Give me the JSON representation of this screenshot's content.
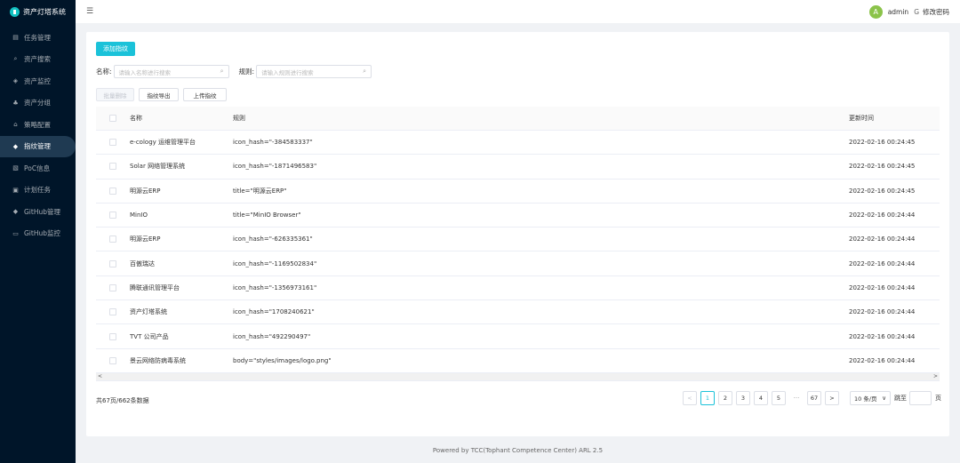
{
  "app": {
    "title": "资产灯塔系统"
  },
  "sidebar": {
    "items": [
      {
        "label": "任务管理",
        "icon": "calendar-icon",
        "glyph": "▤"
      },
      {
        "label": "资产搜索",
        "icon": "search-icon",
        "glyph": "⌕"
      },
      {
        "label": "资产监控",
        "icon": "shield-icon",
        "glyph": "◈"
      },
      {
        "label": "资产分组",
        "icon": "cluster-icon",
        "glyph": "♣"
      },
      {
        "label": "策略配置",
        "icon": "home-icon",
        "glyph": "⌂"
      },
      {
        "label": "指纹管理",
        "icon": "tag-icon",
        "glyph": "◆",
        "active": true
      },
      {
        "label": "PoC信息",
        "icon": "file-icon",
        "glyph": "▧"
      },
      {
        "label": "计划任务",
        "icon": "schedule-icon",
        "glyph": "▣"
      },
      {
        "label": "GitHub管理",
        "icon": "diamond-icon",
        "glyph": "◆"
      },
      {
        "label": "GitHub监控",
        "icon": "monitor-icon",
        "glyph": "▭"
      }
    ]
  },
  "header": {
    "menu_glyph": "☰",
    "avatar_letter": "A",
    "username": "admin",
    "pw_glyph": "G",
    "change_password": "修改密码"
  },
  "toolbar": {
    "add_label": "添加指纹"
  },
  "filters": {
    "name_label": "名称:",
    "name_placeholder": "请输入名称进行搜索",
    "rule_label": "规则:",
    "rule_placeholder": "请输入规则进行搜索",
    "search_glyph": "⌕"
  },
  "actions": {
    "batch_delete": "批量删除",
    "export": "指纹导出",
    "upload": "上传指纹"
  },
  "table": {
    "headers": {
      "name": "名称",
      "rule": "规则",
      "time": "更新时间"
    },
    "rows": [
      {
        "name": "e-cology 运维管理平台",
        "rule": "icon_hash=\"-384583337\"",
        "time": "2022-02-16 00:24:45"
      },
      {
        "name": "Solar 网络管理系统",
        "rule": "icon_hash=\"-1871496583\"",
        "time": "2022-02-16 00:24:45"
      },
      {
        "name": "明源云ERP",
        "rule": "title=\"明源云ERP\"",
        "time": "2022-02-16 00:24:45"
      },
      {
        "name": "MinIO",
        "rule": "title=\"MinIO Browser\"",
        "time": "2022-02-16 00:24:44"
      },
      {
        "name": "明源云ERP",
        "rule": "icon_hash=\"-626335361\"",
        "time": "2022-02-16 00:24:44"
      },
      {
        "name": "百傲瑞达",
        "rule": "icon_hash=\"-1169502834\"",
        "time": "2022-02-16 00:24:44"
      },
      {
        "name": "腾联通讯管理平台",
        "rule": "icon_hash=\"-1356973161\"",
        "time": "2022-02-16 00:24:44"
      },
      {
        "name": "资产灯塔系统",
        "rule": "icon_hash=\"1708240621\"",
        "time": "2022-02-16 00:24:44"
      },
      {
        "name": "TVT 公司产品",
        "rule": "icon_hash=\"492290497\"",
        "time": "2022-02-16 00:24:44"
      },
      {
        "name": "景云网络防病毒系统",
        "rule": "body=\"styles/images/logo.png\"",
        "time": "2022-02-16 00:24:44"
      }
    ],
    "scroll_left": "<",
    "scroll_right": ">"
  },
  "pagination": {
    "total_text": "共67页/662条数据",
    "prev": "<",
    "next": ">",
    "pages": [
      "1",
      "2",
      "3",
      "4",
      "5"
    ],
    "ellipsis": "···",
    "last": "67",
    "page_size": "10 条/页",
    "size_glyph": "∨",
    "jump_label": "跳至",
    "page_suffix": "页"
  },
  "footer": {
    "text": "Powered by TCC(Tophant Competence Center) ARL 2.5"
  },
  "colors": {
    "sidebar_bg": "#001529",
    "accent": "#1bc2d9",
    "avatar": "#8bc34a"
  }
}
